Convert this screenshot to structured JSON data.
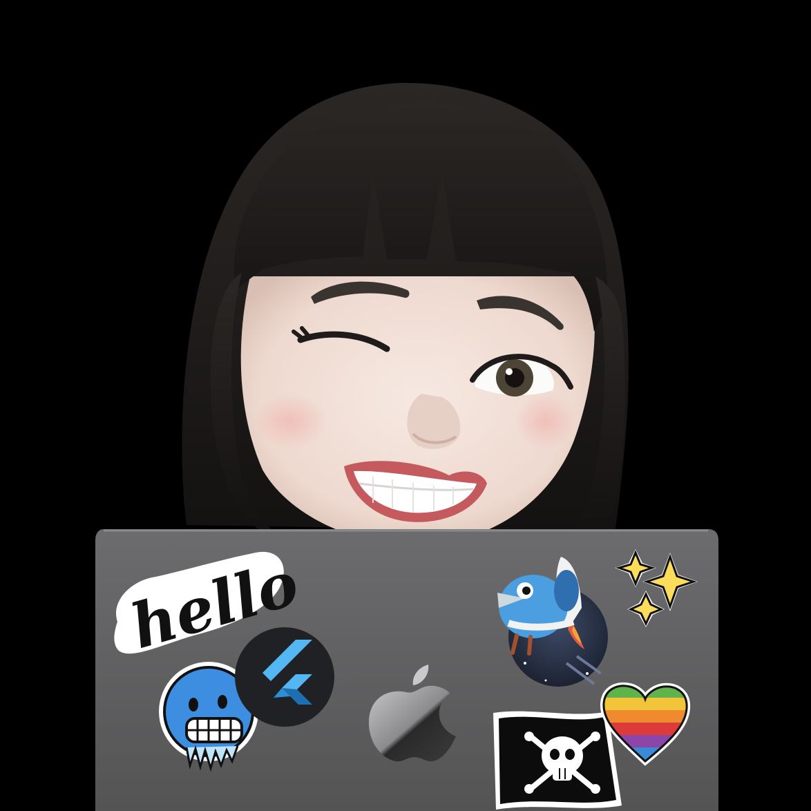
{
  "scene": {
    "background_color": "#000000",
    "subject": "memoji-avatar",
    "expression": "winking-smile",
    "hair_color": "#1e1b1a",
    "skin_color": "#f1dfd6",
    "lip_color": "#c45a5e",
    "laptop_color": "#5e5e5f"
  },
  "stickers": {
    "hello": {
      "text": "hello",
      "icon": "hello-script-sticker"
    },
    "flutter": {
      "icon": "flutter-logo-icon",
      "color": "#54b6f2"
    },
    "cold_face": {
      "icon": "cold-face-emoji-icon",
      "color": "#3d8ee0"
    },
    "apple_logo": {
      "icon": "apple-logo-icon"
    },
    "dart_bird": {
      "icon": "dart-bird-rocket-icon",
      "color": "#4b9ee0"
    },
    "sparkles": {
      "icon": "sparkles-icon",
      "color": "#fbdc5b"
    },
    "pirate_flag": {
      "icon": "pirate-flag-icon"
    },
    "rainbow_heart": {
      "icon": "rainbow-heart-icon",
      "stripes": [
        "#5fb34a",
        "#f2c43a",
        "#f08a2e",
        "#dd3b3b",
        "#8c46a8",
        "#3a8ad8"
      ]
    }
  }
}
